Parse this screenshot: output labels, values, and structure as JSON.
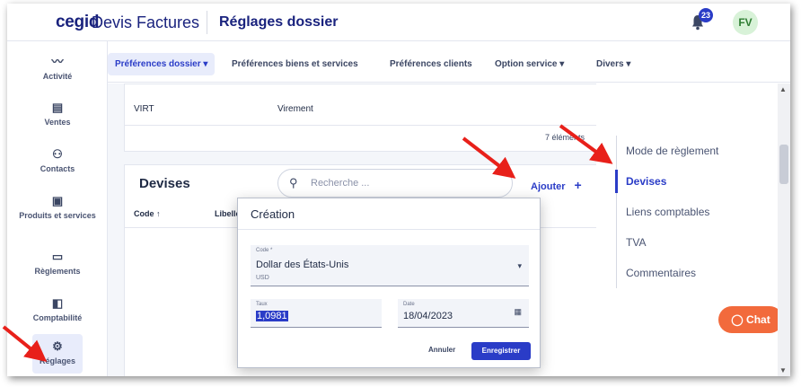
{
  "app": {
    "logo": "cegid",
    "name": "Devis Factures",
    "page_title": "Réglages dossier",
    "notification_count": "23",
    "avatar_initials": "FV"
  },
  "left_nav": [
    {
      "label": "Activité",
      "icon": "activity-icon"
    },
    {
      "label": "Ventes",
      "icon": "document-icon"
    },
    {
      "label": "Contacts",
      "icon": "people-icon"
    },
    {
      "label": "Produits et services",
      "icon": "box-icon"
    },
    {
      "label": "Règlements",
      "icon": "card-icon"
    },
    {
      "label": "Comptabilité",
      "icon": "ledger-icon"
    },
    {
      "label": "Réglages",
      "icon": "gear-icon",
      "active": true
    }
  ],
  "tabs": [
    {
      "label": "Préférences dossier",
      "active": true,
      "dropdown": true
    },
    {
      "label": "Préférences biens et services"
    },
    {
      "label": "Préférences clients"
    },
    {
      "label": "Option service",
      "dropdown": true
    },
    {
      "label": "Divers",
      "dropdown": true
    }
  ],
  "payment_table": {
    "row": {
      "code": "VIRT",
      "label": "Virement"
    },
    "count": "7 éléments"
  },
  "devises": {
    "title": "Devises",
    "search_placeholder": "Recherche ...",
    "add_label": "Ajouter",
    "col_code": "Code",
    "col_libelle": "Libellé"
  },
  "right_nav": [
    {
      "label": "Mode de règlement"
    },
    {
      "label": "Devises",
      "active": true
    },
    {
      "label": "Liens comptables"
    },
    {
      "label": "TVA"
    },
    {
      "label": "Commentaires"
    }
  ],
  "chat_label": "Chat",
  "modal": {
    "title": "Création",
    "code_label": "Code *",
    "code_value": "Dollar des États-Unis",
    "code_sub": "USD",
    "taux_label": "Taux",
    "taux_value": "1,0981",
    "date_label": "Date",
    "date_value": "18/04/2023",
    "cancel_label": "Annuler",
    "save_label": "Enregistrer"
  },
  "colors": {
    "brand": "#1a237e",
    "accent": "#2a3cc7",
    "chat": "#f26a3c",
    "annotation_arrow": "#e8201a"
  }
}
